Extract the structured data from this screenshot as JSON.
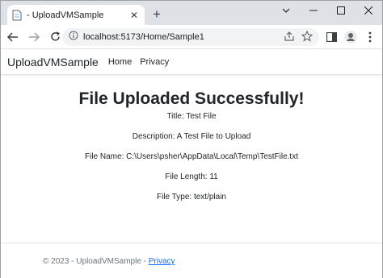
{
  "browser": {
    "tab_title": "- UploadVMSample",
    "url": "localhost:5173/Home/Sample1"
  },
  "site": {
    "brand": "UploadVMSample",
    "nav": [
      "Home",
      "Privacy"
    ]
  },
  "main": {
    "heading": "File Uploaded Successfully!",
    "title": "Title: Test File",
    "description": "Description: A Test File to Upload",
    "file_name": "File Name: C:\\Users\\psher\\AppData\\Local\\Temp\\TestFile.txt",
    "file_length": "File Length: 11",
    "file_type": "File Type: text/plain"
  },
  "footer": {
    "copyright": "© 2023 - UploadVMSample - ",
    "privacy_link": "Privacy"
  },
  "colors": {
    "tabstrip_bg": "#dee1e6",
    "link": "#0d6efd",
    "footer_text": "#6c757d"
  }
}
